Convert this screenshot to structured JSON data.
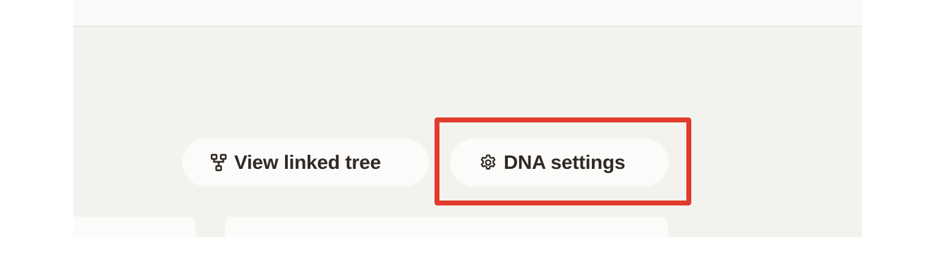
{
  "toolbar": {
    "buttons": [
      {
        "label": "View linked tree",
        "icon": "tree-icon"
      },
      {
        "label": "DNA settings",
        "icon": "gear-icon"
      }
    ]
  },
  "colors": {
    "background": "#f3f2ef",
    "top_bar": "#faf9f8",
    "button_bg": "#fcfbfa",
    "text": "#2d2a27",
    "highlight": "#e13b2c"
  }
}
